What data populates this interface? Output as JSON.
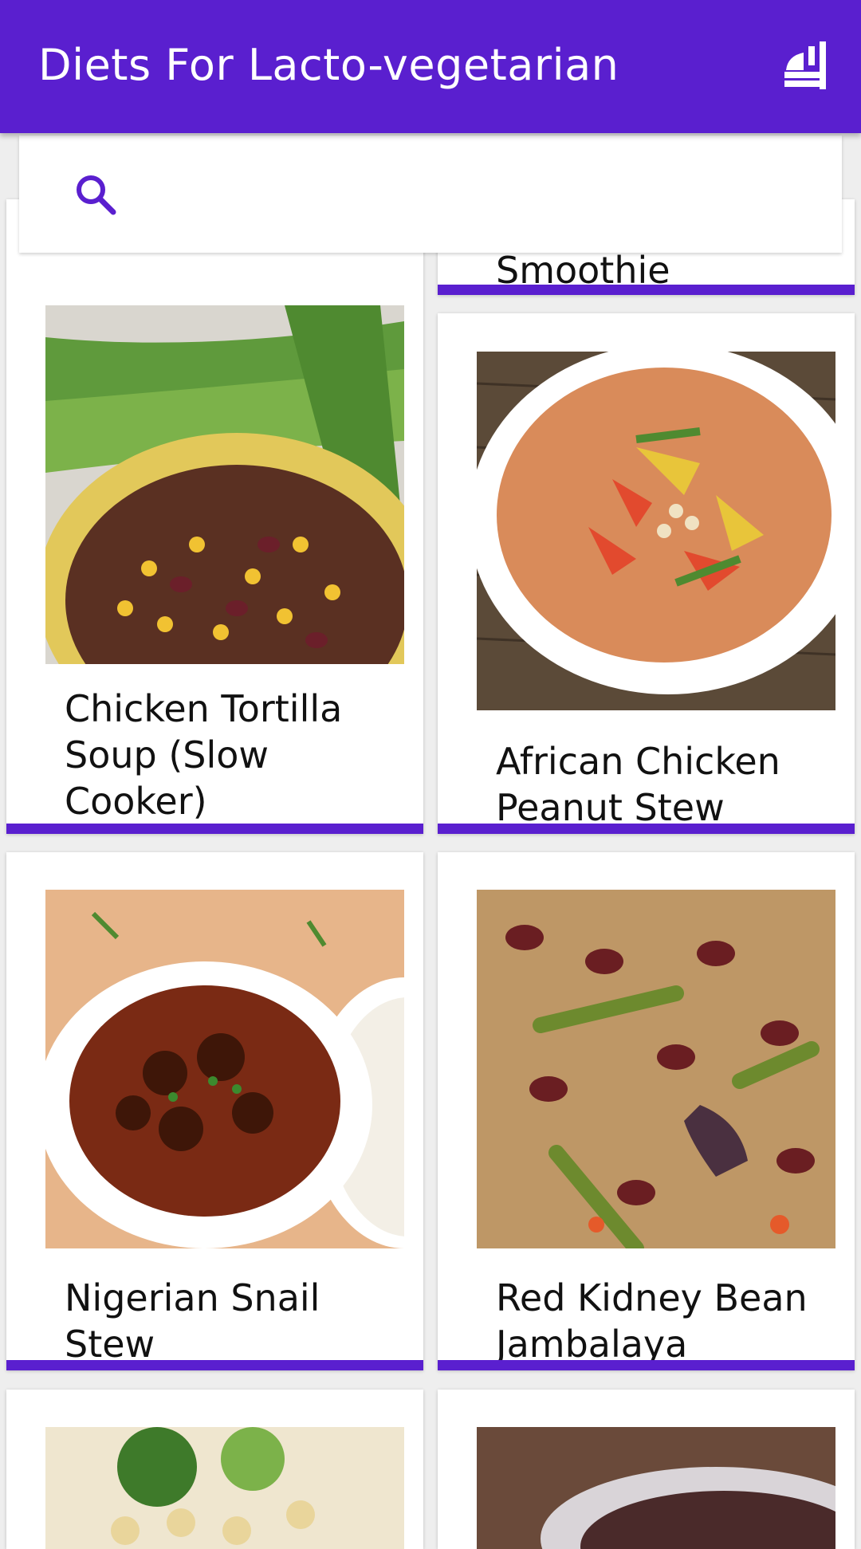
{
  "app_bar": {
    "title": "Diets For Lacto-vegetarian",
    "action_icon": "restaurant-menu-icon"
  },
  "search": {
    "placeholder": "",
    "value": "",
    "icon": "search-icon"
  },
  "colors": {
    "primary": "#5a1fcf",
    "on_primary": "#ffffff",
    "background": "#eeeeee",
    "card": "#ffffff"
  },
  "recipes": [
    {
      "title": "Smoothie"
    },
    {
      "title": "Chicken Tortilla Soup (Slow Cooker)"
    },
    {
      "title": "African Chicken Peanut Stew"
    },
    {
      "title": "Nigerian Snail Stew"
    },
    {
      "title": "Red Kidney Bean Jambalaya"
    },
    {
      "title": ""
    },
    {
      "title": ""
    }
  ]
}
